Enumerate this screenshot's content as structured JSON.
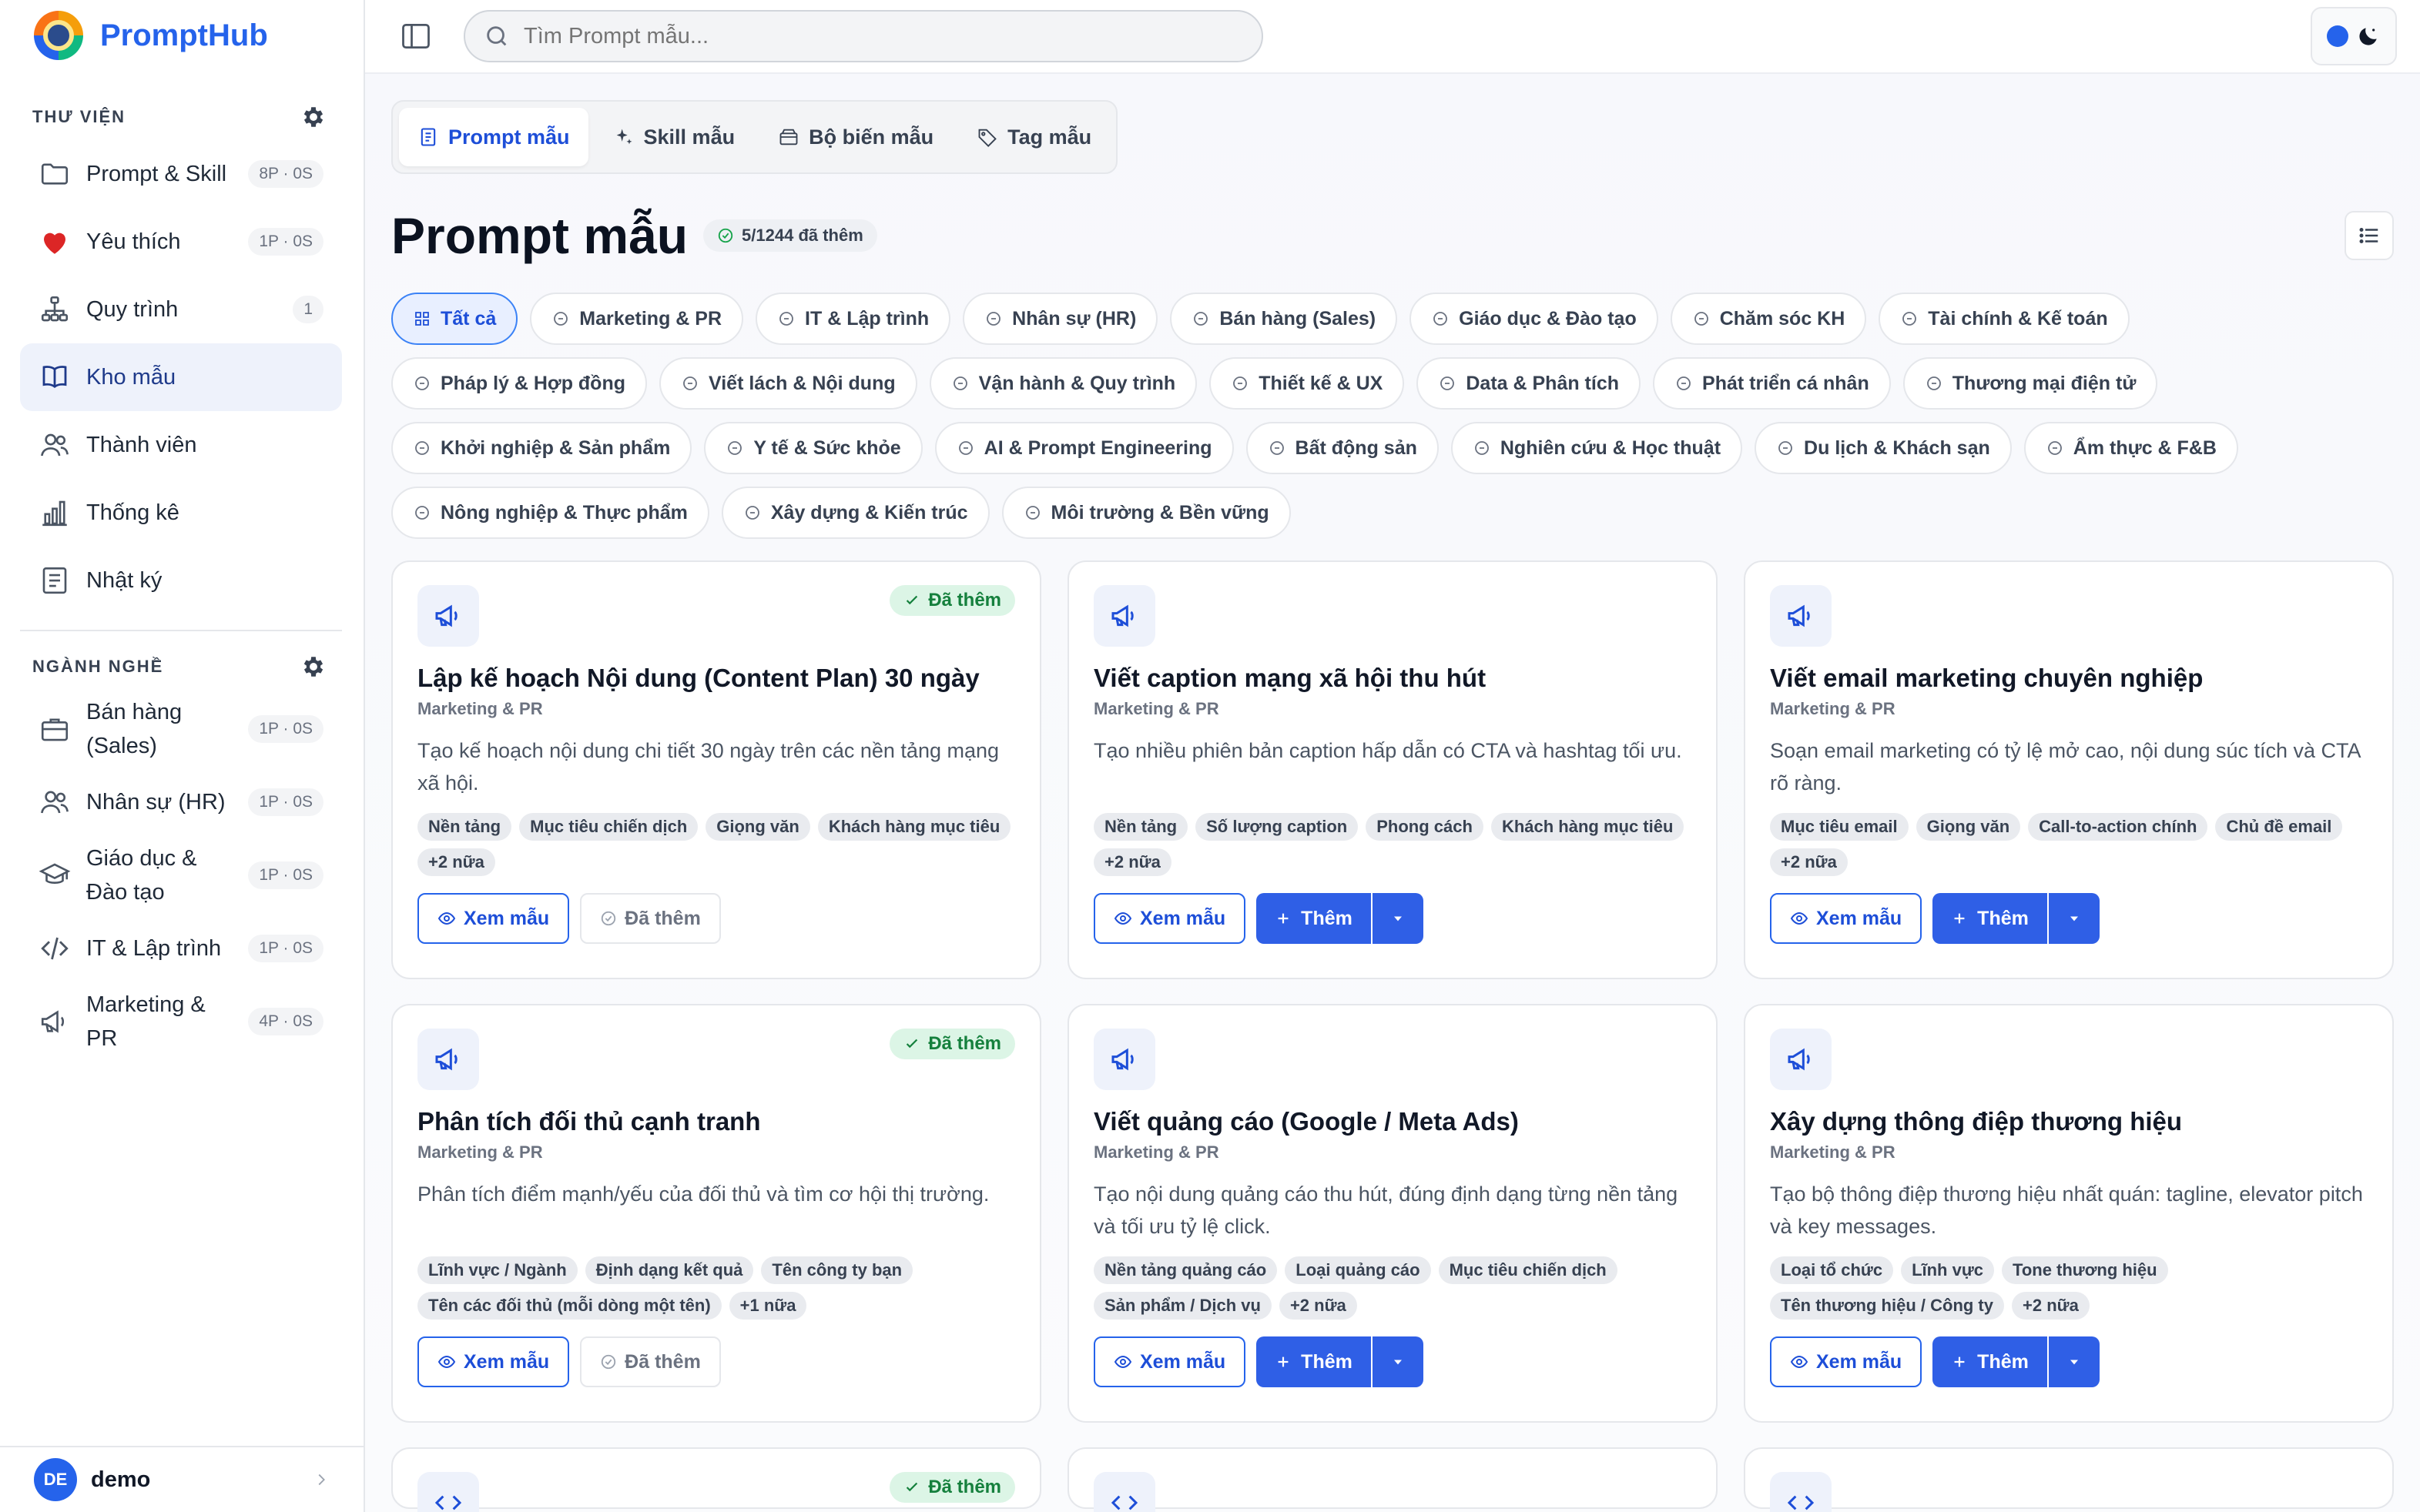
{
  "brand": {
    "name": "PromptHub"
  },
  "sidebar": {
    "library_label": "THƯ VIỆN",
    "library_items": [
      {
        "label": "Prompt & Skill",
        "count": "8P · 0S",
        "icon": "folder-icon"
      },
      {
        "label": "Yêu thích",
        "count": "1P · 0S",
        "icon": "heart-icon"
      },
      {
        "label": "Quy trình",
        "count": "1",
        "icon": "workflow-icon"
      },
      {
        "label": "Kho mẫu",
        "count": "",
        "icon": "book-icon"
      },
      {
        "label": "Thành viên",
        "count": "",
        "icon": "users-icon"
      },
      {
        "label": "Thống kê",
        "count": "",
        "icon": "bar-chart-icon"
      },
      {
        "label": "Nhật ký",
        "count": "",
        "icon": "log-icon"
      }
    ],
    "industry_label": "NGÀNH NGHỀ",
    "industry_items": [
      {
        "label_1": "Bán hàng",
        "label_2": "(Sales)",
        "count": "1P · 0S"
      },
      {
        "label_1": "Nhân sự (HR)",
        "label_2": "",
        "count": "1P · 0S"
      },
      {
        "label_1": "Giáo dục &",
        "label_2": "Đào tạo",
        "count": "1P · 0S"
      },
      {
        "label_1": "IT & Lập trình",
        "label_2": "",
        "count": "1P · 0S"
      },
      {
        "label_1": "Marketing &",
        "label_2": "PR",
        "count": "4P · 0S"
      }
    ],
    "user": {
      "initials": "DE",
      "name": "demo"
    }
  },
  "search": {
    "placeholder": "Tìm Prompt mẫu..."
  },
  "tabs": [
    "Prompt mẫu",
    "Skill mẫu",
    "Bộ biến mẫu",
    "Tag mẫu"
  ],
  "page": {
    "title": "Prompt mẫu",
    "added_badge": "5/1244 đã thêm"
  },
  "categories": [
    "Tất cả",
    "Marketing & PR",
    "IT & Lập trình",
    "Nhân sự (HR)",
    "Bán hàng (Sales)",
    "Giáo dục & Đào tạo",
    "Chăm sóc KH",
    "Tài chính & Kế toán",
    "Pháp lý & Hợp đồng",
    "Viết lách & Nội dung",
    "Vận hành & Quy trình",
    "Thiết kế & UX",
    "Data & Phân tích",
    "Phát triển cá nhân",
    "Thương mại điện tử",
    "Khởi nghiệp & Sản phẩm",
    "Y tế & Sức khỏe",
    "AI & Prompt Engineering",
    "Bất động sản",
    "Nghiên cứu & Học thuật",
    "Du lịch & Khách sạn",
    "Ẩm thực & F&B",
    "Nông nghiệp & Thực phẩm",
    "Xây dựng & Kiến trúc",
    "Môi trường & Bền vững"
  ],
  "labels": {
    "added": "Đã thêm",
    "view": "Xem mẫu",
    "add": "Thêm"
  },
  "cards": [
    {
      "title": "Lập kế hoạch Nội dung (Content Plan) 30 ngày",
      "category": "Marketing & PR",
      "description": "Tạo kế hoạch nội dung chi tiết 30 ngày trên các nền tảng mạng xã hội.",
      "vars": [
        "Nền tảng",
        "Mục tiêu chiến dịch",
        "Giọng văn",
        "Khách hàng mục tiêu",
        "+2 nữa"
      ],
      "added": true
    },
    {
      "title": "Viết caption mạng xã hội thu hút",
      "category": "Marketing & PR",
      "description": "Tạo nhiều phiên bản caption hấp dẫn có CTA và hashtag tối ưu.",
      "vars": [
        "Nền tảng",
        "Số lượng caption",
        "Phong cách",
        "Khách hàng mục tiêu",
        "+2 nữa"
      ],
      "added": false
    },
    {
      "title": "Viết email marketing chuyên nghiệp",
      "category": "Marketing & PR",
      "description": "Soạn email marketing có tỷ lệ mở cao, nội dung súc tích và CTA rõ ràng.",
      "vars": [
        "Mục tiêu email",
        "Giọng văn",
        "Call-to-action chính",
        "Chủ đề email",
        "+2 nữa"
      ],
      "added": false
    },
    {
      "title": "Phân tích đối thủ cạnh tranh",
      "category": "Marketing & PR",
      "description": "Phân tích điểm mạnh/yếu của đối thủ và tìm cơ hội thị trường.",
      "vars": [
        "Lĩnh vực / Ngành",
        "Định dạng kết quả",
        "Tên công ty bạn",
        "Tên các đối thủ (mỗi dòng một tên)",
        "+1 nữa"
      ],
      "added": true
    },
    {
      "title": "Viết quảng cáo (Google / Meta Ads)",
      "category": "Marketing & PR",
      "description": "Tạo nội dung quảng cáo thu hút, đúng định dạng từng nền tảng và tối ưu tỷ lệ click.",
      "vars": [
        "Nền tảng quảng cáo",
        "Loại quảng cáo",
        "Mục tiêu chiến dịch",
        "Sản phẩm / Dịch vụ",
        "+2 nữa"
      ],
      "added": false
    },
    {
      "title": "Xây dựng thông điệp thương hiệu",
      "category": "Marketing & PR",
      "description": "Tạo bộ thông điệp thương hiệu nhất quán: tagline, elevator pitch và key messages.",
      "vars": [
        "Loại tổ chức",
        "Lĩnh vực",
        "Tone thương hiệu",
        "Tên thương hiệu / Công ty",
        "+2 nữa"
      ],
      "added": false
    }
  ],
  "colors": {
    "accent": "#2563eb",
    "added_bg": "#dcf5e6",
    "added_fg": "#15803d"
  }
}
